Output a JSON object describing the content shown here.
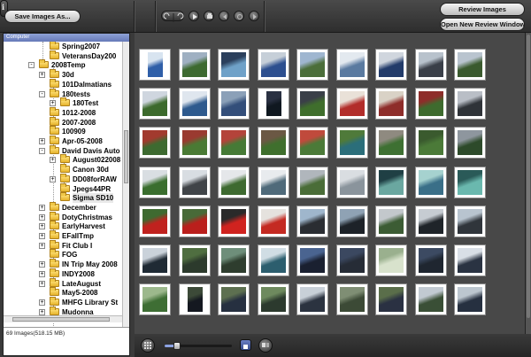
{
  "toolbar": {
    "save_label": "Save Images As...",
    "review_label": "Review Images",
    "new_window_label": "Open New Review Window",
    "info_glyph": "i",
    "tools": [
      "rotate-left-icon",
      "rotate-right-icon",
      "play-icon",
      "print-icon",
      "back-icon",
      "refresh-icon",
      "forward-icon",
      "options-icon"
    ]
  },
  "left_panel": {
    "header": "Computer",
    "status": "69 Images(518.15 MB)",
    "tree": [
      {
        "label": "Spring2007",
        "level": 2,
        "expander": "",
        "selected": false
      },
      {
        "label": "VeteransDay200",
        "level": 2,
        "expander": "",
        "selected": false
      },
      {
        "label": "2008Temp",
        "level": 1,
        "expander": "-",
        "selected": false
      },
      {
        "label": "30d",
        "level": 2,
        "expander": "+",
        "selected": false
      },
      {
        "label": "101Dalmatians",
        "level": 2,
        "expander": "",
        "selected": false
      },
      {
        "label": "180tests",
        "level": 2,
        "expander": "-",
        "selected": false
      },
      {
        "label": "180Test",
        "level": 3,
        "expander": "+",
        "selected": false
      },
      {
        "label": "1012-2008",
        "level": 2,
        "expander": "",
        "selected": false
      },
      {
        "label": "2007-2008",
        "level": 2,
        "expander": "",
        "selected": false
      },
      {
        "label": "100909",
        "level": 2,
        "expander": "",
        "selected": false
      },
      {
        "label": "Apr-05-2008",
        "level": 2,
        "expander": "+",
        "selected": false
      },
      {
        "label": "David Davis Auto",
        "level": 2,
        "expander": "-",
        "selected": false
      },
      {
        "label": "August022008",
        "level": 3,
        "expander": "+",
        "selected": false
      },
      {
        "label": "Canon 30d",
        "level": 3,
        "expander": "",
        "selected": false
      },
      {
        "label": "DD08forRAW",
        "level": 3,
        "expander": "+",
        "selected": false
      },
      {
        "label": "Jpegs44PR",
        "level": 3,
        "expander": "",
        "selected": false
      },
      {
        "label": "Sigma SD10",
        "level": 3,
        "expander": "",
        "selected": true
      },
      {
        "label": "December",
        "level": 2,
        "expander": "+",
        "selected": false
      },
      {
        "label": "DotyChristmas",
        "level": 2,
        "expander": "+",
        "selected": false
      },
      {
        "label": "EarlyHarvest",
        "level": 2,
        "expander": "+",
        "selected": false
      },
      {
        "label": "EFallTmp",
        "level": 2,
        "expander": "+",
        "selected": false
      },
      {
        "label": "Fit Club I",
        "level": 2,
        "expander": "+",
        "selected": false
      },
      {
        "label": "FOG",
        "level": 2,
        "expander": "",
        "selected": false
      },
      {
        "label": "IN Trip May 2008",
        "level": 2,
        "expander": "+",
        "selected": false
      },
      {
        "label": "INDY2008",
        "level": 2,
        "expander": "+",
        "selected": false
      },
      {
        "label": "LateAugust",
        "level": 2,
        "expander": "+",
        "selected": false
      },
      {
        "label": "May5-2008",
        "level": 2,
        "expander": "",
        "selected": false
      },
      {
        "label": "MHFG Library St",
        "level": 2,
        "expander": "+",
        "selected": false
      },
      {
        "label": "Mudonna",
        "level": 2,
        "expander": "+",
        "selected": false
      }
    ]
  },
  "grid": {
    "rows": [
      [
        {
          "c1": "#2f5fa8",
          "c2": "#d8e4f0",
          "portrait": true
        },
        {
          "c1": "#3d6a30",
          "c2": "#9fb0c2",
          "portrait": false
        },
        {
          "c1": "#6fa1c8",
          "c2": "#2b3f5c",
          "portrait": false
        },
        {
          "c1": "#2d4f8f",
          "c2": "#c6cfd8",
          "portrait": false
        },
        {
          "c1": "#4b6e3a",
          "c2": "#9fb6d0",
          "portrait": false
        },
        {
          "c1": "#5a7aa0",
          "c2": "#e3e9ef",
          "portrait": false
        },
        {
          "c1": "#223b6a",
          "c2": "#d0d6de",
          "portrait": false
        },
        {
          "c1": "#3a3f48",
          "c2": "#b8c2cc",
          "portrait": false
        },
        {
          "c1": "#3a5a2e",
          "c2": "#b9c4cf",
          "portrait": false
        }
      ],
      [
        {
          "c1": "#3c6a2c",
          "c2": "#cfd6df",
          "portrait": false
        },
        {
          "c1": "#2e5a8e",
          "c2": "#dfe6ee",
          "portrait": false
        },
        {
          "c1": "#334e7a",
          "c2": "#8ba0b8",
          "portrait": false
        },
        {
          "c1": "#101820",
          "c2": "#2a3142",
          "portrait": true
        },
        {
          "c1": "#3f6e2c",
          "c2": "#3a3f48",
          "portrait": false
        },
        {
          "c1": "#b22d2a",
          "c2": "#e9e1d8",
          "portrait": false
        },
        {
          "c1": "#8e2d2a",
          "c2": "#d9d2c6",
          "portrait": false
        },
        {
          "c1": "#3e6b2e",
          "c2": "#8e2d2a",
          "portrait": false
        },
        {
          "c1": "#2f3338",
          "c2": "#b9bec6",
          "portrait": false
        }
      ],
      [
        {
          "c1": "#3d6a30",
          "c2": "#a23a2e",
          "portrait": false
        },
        {
          "c1": "#4a7a34",
          "c2": "#9a3a30",
          "portrait": false
        },
        {
          "c1": "#467a36",
          "c2": "#b4433a",
          "portrait": false
        },
        {
          "c1": "#3f6f2d",
          "c2": "#6b5844",
          "portrait": false
        },
        {
          "c1": "#4b7a38",
          "c2": "#c04a3c",
          "portrait": false
        },
        {
          "c1": "#2b6e7a",
          "c2": "#4f7a3a",
          "portrait": false
        },
        {
          "c1": "#3e7032",
          "c2": "#8f8a80",
          "portrait": false
        },
        {
          "c1": "#4b7a38",
          "c2": "#3a5a2e",
          "portrait": false
        },
        {
          "c1": "#2d4a2a",
          "c2": "#8e969e",
          "portrait": false
        }
      ],
      [
        {
          "c1": "#3a6e2e",
          "c2": "#d9dee2",
          "portrait": false
        },
        {
          "c1": "#404448",
          "c2": "#d8dde2",
          "portrait": false
        },
        {
          "c1": "#3e6a30",
          "c2": "#e5e7ea",
          "portrait": false
        },
        {
          "c1": "#4f6a7a",
          "c2": "#e8ebee",
          "portrait": false
        },
        {
          "c1": "#4a6d38",
          "c2": "#b0b6bc",
          "portrait": false
        },
        {
          "c1": "#8a949c",
          "c2": "#d9dde1",
          "portrait": false
        },
        {
          "c1": "#6aa7a0",
          "c2": "#1f3f44",
          "portrait": false
        },
        {
          "c1": "#3a6f88",
          "c2": "#a6d2cf",
          "portrait": false
        },
        {
          "c1": "#6ab8ae",
          "c2": "#2a5a58",
          "portrait": false
        }
      ],
      [
        {
          "c1": "#c0221e",
          "c2": "#3e6a30",
          "portrait": false
        },
        {
          "c1": "#ba1f1c",
          "c2": "#486a38",
          "portrait": false
        },
        {
          "c1": "#d0231f",
          "c2": "#2a2a2a",
          "portrait": false
        },
        {
          "c1": "#c42a22",
          "c2": "#e5e2de",
          "portrait": false
        },
        {
          "c1": "#2a2d32",
          "c2": "#9fb6cc",
          "portrait": false
        },
        {
          "c1": "#1d2228",
          "c2": "#8fa2b4",
          "portrait": false
        },
        {
          "c1": "#3c5c34",
          "c2": "#c3c8cc",
          "portrait": false
        },
        {
          "c1": "#1f2429",
          "c2": "#c6ccd2",
          "portrait": false
        },
        {
          "c1": "#30353b",
          "c2": "#b8c4cf",
          "portrait": false
        }
      ],
      [
        {
          "c1": "#1f2a34",
          "c2": "#cad2da",
          "portrait": false
        },
        {
          "c1": "#2c3a2c",
          "c2": "#4f6e40",
          "portrait": false
        },
        {
          "c1": "#2e3d2e",
          "c2": "#6e8e7a",
          "portrait": false
        },
        {
          "c1": "#2c5e6e",
          "c2": "#d0dde4",
          "portrait": false
        },
        {
          "c1": "#1a2030",
          "c2": "#4a6490",
          "portrait": false
        },
        {
          "c1": "#262c36",
          "c2": "#3b4860",
          "portrait": false
        },
        {
          "c1": "#d8e2cc",
          "c2": "#9ab08e",
          "portrait": false
        },
        {
          "c1": "#1f2630",
          "c2": "#3c4a62",
          "portrait": false
        },
        {
          "c1": "#2a3342",
          "c2": "#d9dfe6",
          "portrait": false
        }
      ],
      [
        {
          "c1": "#3e6e34",
          "c2": "#9cb88c",
          "portrait": false
        },
        {
          "c1": "#141820",
          "c2": "#3c4a38",
          "portrait": true
        },
        {
          "c1": "#263040",
          "c2": "#5d7050",
          "portrait": false
        },
        {
          "c1": "#2c3a2e",
          "c2": "#6e8a5e",
          "portrait": false
        },
        {
          "c1": "#2b3340",
          "c2": "#c8d0d8",
          "portrait": false
        },
        {
          "c1": "#3c4a36",
          "c2": "#7f8e74",
          "portrait": false
        },
        {
          "c1": "#2a3142",
          "c2": "#5a6e4a",
          "portrait": false
        },
        {
          "c1": "#3a4f36",
          "c2": "#c2cad2",
          "portrait": false
        },
        {
          "c1": "#263040",
          "c2": "#bcc6cf",
          "portrait": false
        }
      ]
    ]
  },
  "colors": {
    "accent_blue": "#8da3e3",
    "panel_head": "#6f82c2",
    "app_bg": "#3a3a3a"
  },
  "bottom_toolbar": {
    "zoom_fraction": 0.18,
    "icons": [
      "grid-view-icon",
      "single-view-icon",
      "compare-view-icon"
    ]
  }
}
